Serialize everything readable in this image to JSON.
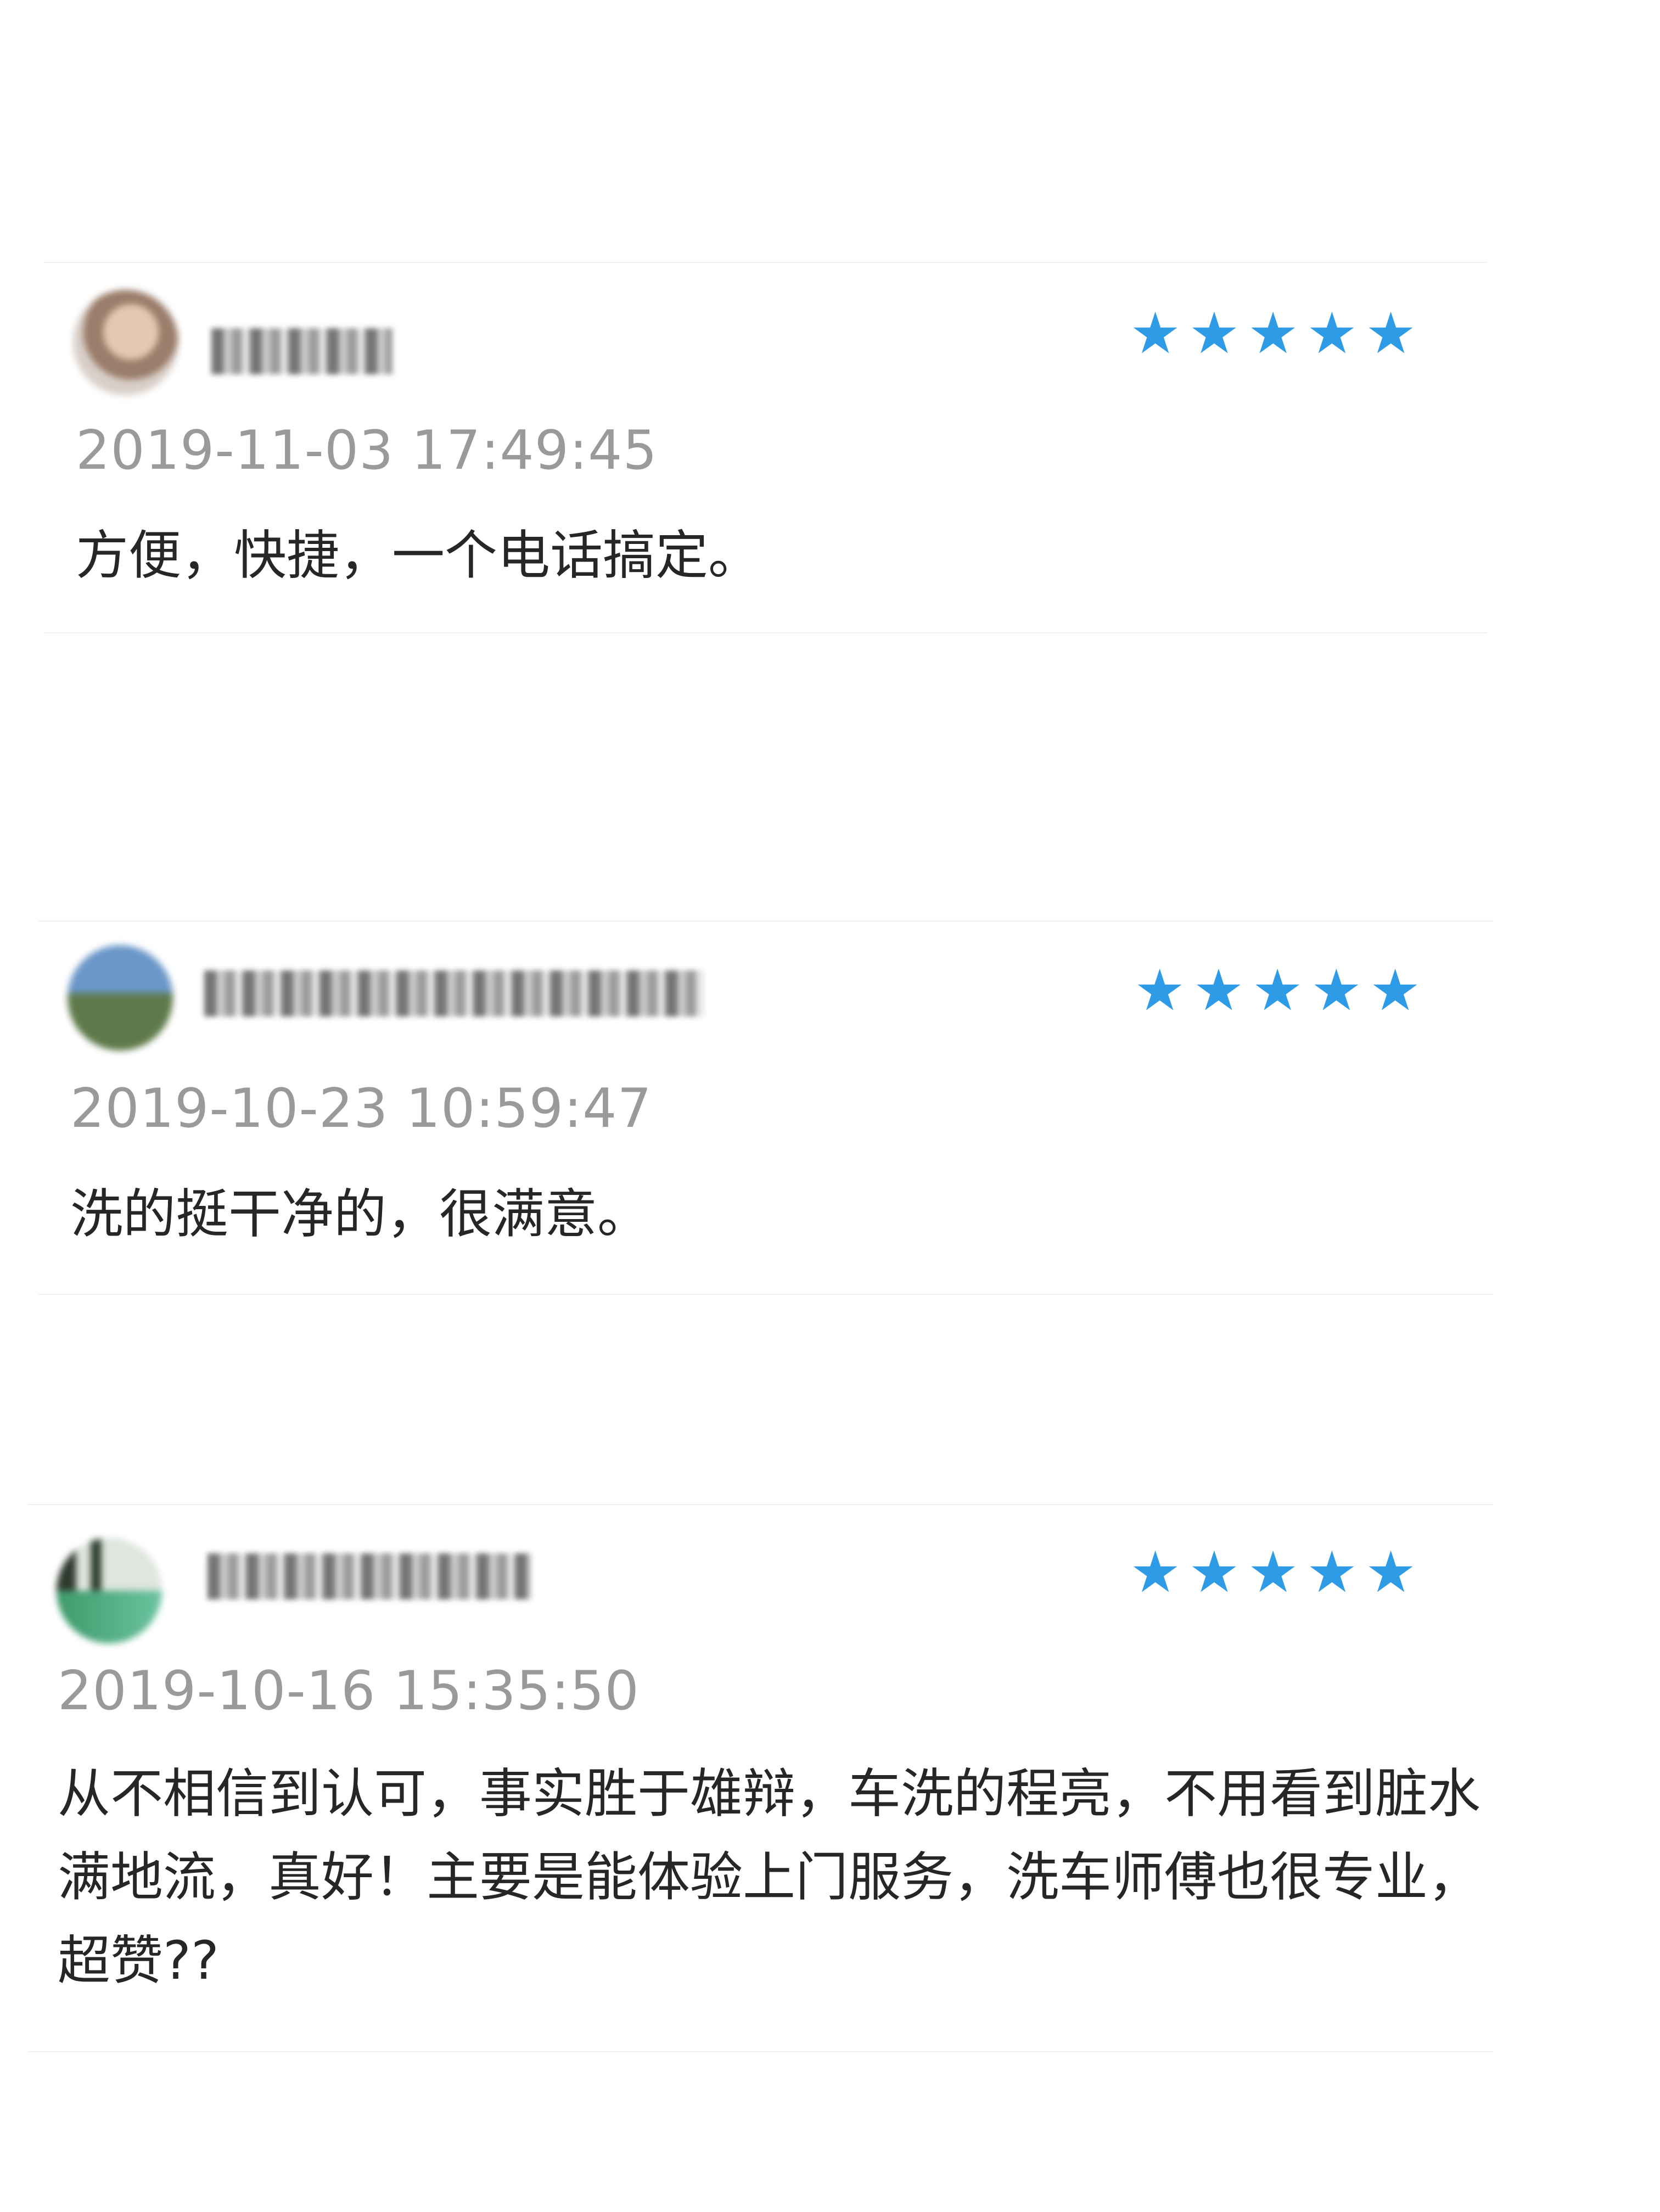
{
  "reviews": [
    {
      "username": "",
      "rating": 5,
      "timestamp": "2019-11-03 17:49:45",
      "comment": "方便，快捷，一个电话搞定。"
    },
    {
      "username": "",
      "rating": 5,
      "timestamp": "2019-10-23 10:59:47",
      "comment": "洗的挺干净的，很满意。"
    },
    {
      "username": "",
      "rating": 5,
      "timestamp": "2019-10-16 15:35:50",
      "comment": "从不相信到认可，事实胜于雄辩，车洗的程亮，不用看到脏水满地流，真好！主要是能体验上门服务，洗车师傅也很专业，超赞??"
    }
  ],
  "star_icon": "star-icon",
  "colors": {
    "star": "#2e9be6",
    "timestamp": "#9a9a9a",
    "divider": "#f1f1f1"
  }
}
